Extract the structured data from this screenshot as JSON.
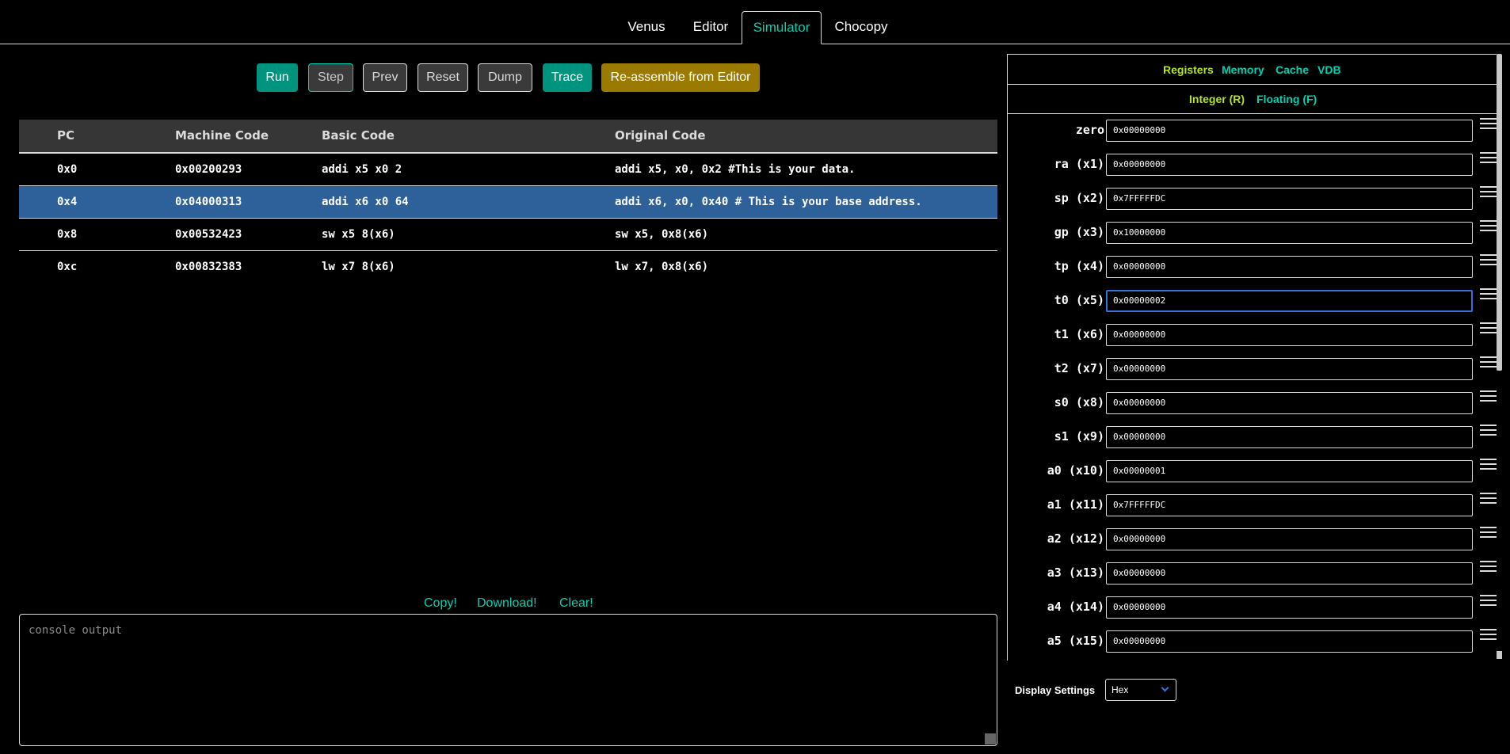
{
  "nav": {
    "tabs": [
      "Venus",
      "Editor",
      "Simulator",
      "Chocopy"
    ],
    "active": "Simulator"
  },
  "toolbar": {
    "run": "Run",
    "step": "Step",
    "prev": "Prev",
    "reset": "Reset",
    "dump": "Dump",
    "trace": "Trace",
    "reassemble": "Re-assemble from Editor"
  },
  "program": {
    "headers": [
      "PC",
      "Machine Code",
      "Basic Code",
      "Original Code"
    ],
    "rows": [
      [
        "0x0",
        "0x00200293",
        "addi x5 x0 2",
        "addi x5, x0, 0x2 #This is your data."
      ],
      [
        "0x4",
        "0x04000313",
        "addi x6 x0 64",
        "addi x6, x0, 0x40 # This is your base address."
      ],
      [
        "0x8",
        "0x00532423",
        "sw x5 8(x6)",
        "sw x5, 0x8(x6)"
      ],
      [
        "0xc",
        "0x00832383",
        "lw x7 8(x6)",
        "lw x7, 0x8(x6)"
      ]
    ],
    "selected_row": 1
  },
  "console": {
    "copy": "Copy!",
    "download": "Download!",
    "clear": "Clear!",
    "placeholder": "console output"
  },
  "panel": {
    "tabs": [
      "Registers",
      "Memory",
      "Cache",
      "VDB"
    ],
    "subtabs": [
      "Integer (R)",
      "Floating (F)"
    ],
    "registers": [
      [
        "zero",
        "0x00000000"
      ],
      [
        "ra (x1)",
        "0x00000000"
      ],
      [
        "sp (x2)",
        "0x7FFFFFDC"
      ],
      [
        "gp (x3)",
        "0x10000000"
      ],
      [
        "tp (x4)",
        "0x00000000"
      ],
      [
        "t0 (x5)",
        "0x00000002"
      ],
      [
        "t1 (x6)",
        "0x00000000"
      ],
      [
        "t2 (x7)",
        "0x00000000"
      ],
      [
        "s0 (x8)",
        "0x00000000"
      ],
      [
        "s1 (x9)",
        "0x00000000"
      ],
      [
        "a0 (x10)",
        "0x00000001"
      ],
      [
        "a1 (x11)",
        "0x7FFFFFDC"
      ],
      [
        "a2 (x12)",
        "0x00000000"
      ],
      [
        "a3 (x13)",
        "0x00000000"
      ],
      [
        "a4 (x14)",
        "0x00000000"
      ],
      [
        "a5 (x15)",
        "0x00000000"
      ]
    ],
    "focused_register": 5,
    "display_settings_label": "Display Settings",
    "display_format": "Hex"
  }
}
